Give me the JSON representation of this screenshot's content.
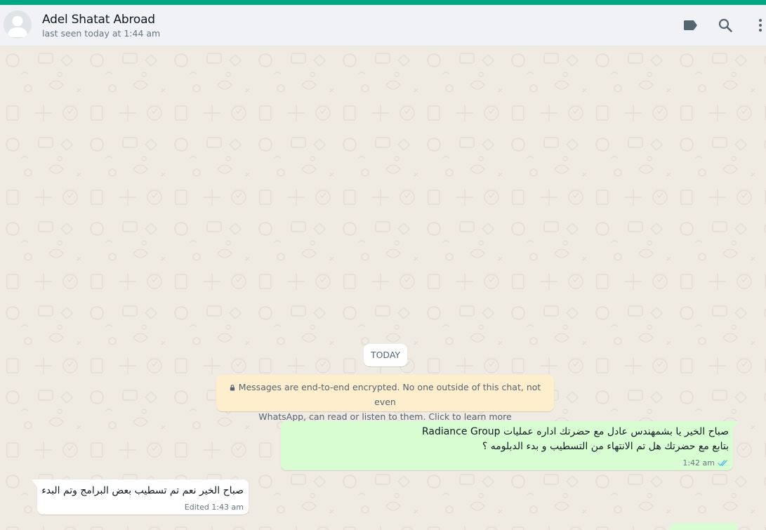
{
  "header": {
    "contact_name": "Adel Shatat Abroad",
    "status": "last seen today at 1:44 am",
    "icons": [
      "label-icon",
      "search-icon",
      "menu-icon"
    ]
  },
  "chat": {
    "date_divider": "TODAY",
    "encryption_notice_line1": "Messages are end-to-end encrypted. No one outside of this chat, not even",
    "encryption_notice_line2": "WhatsApp, can read or listen to them. Click to learn more",
    "messages": [
      {
        "direction": "outgoing",
        "line1": "صباح الخير يا بشمهندس عادل  مع  حضرتك اداره عمليات Radiance Group",
        "line2": "بتابع مع حضرتك هل تم الانتهاء من التسطيب و بدء الدبلومه ؟",
        "time": "1:42 am",
        "status": "read"
      },
      {
        "direction": "incoming",
        "text": "صباح الخير نعم تم تسطيب بعض البرامج وتم البدء",
        "time": "Edited 1:43 am"
      }
    ]
  },
  "colors": {
    "accent": "#00a884",
    "outgoing_bubble": "#d9fdd3",
    "incoming_bubble": "#ffffff",
    "notice_bg": "#ffeecd",
    "chat_bg": "#efeae2",
    "read_ticks": "#53bdeb"
  }
}
